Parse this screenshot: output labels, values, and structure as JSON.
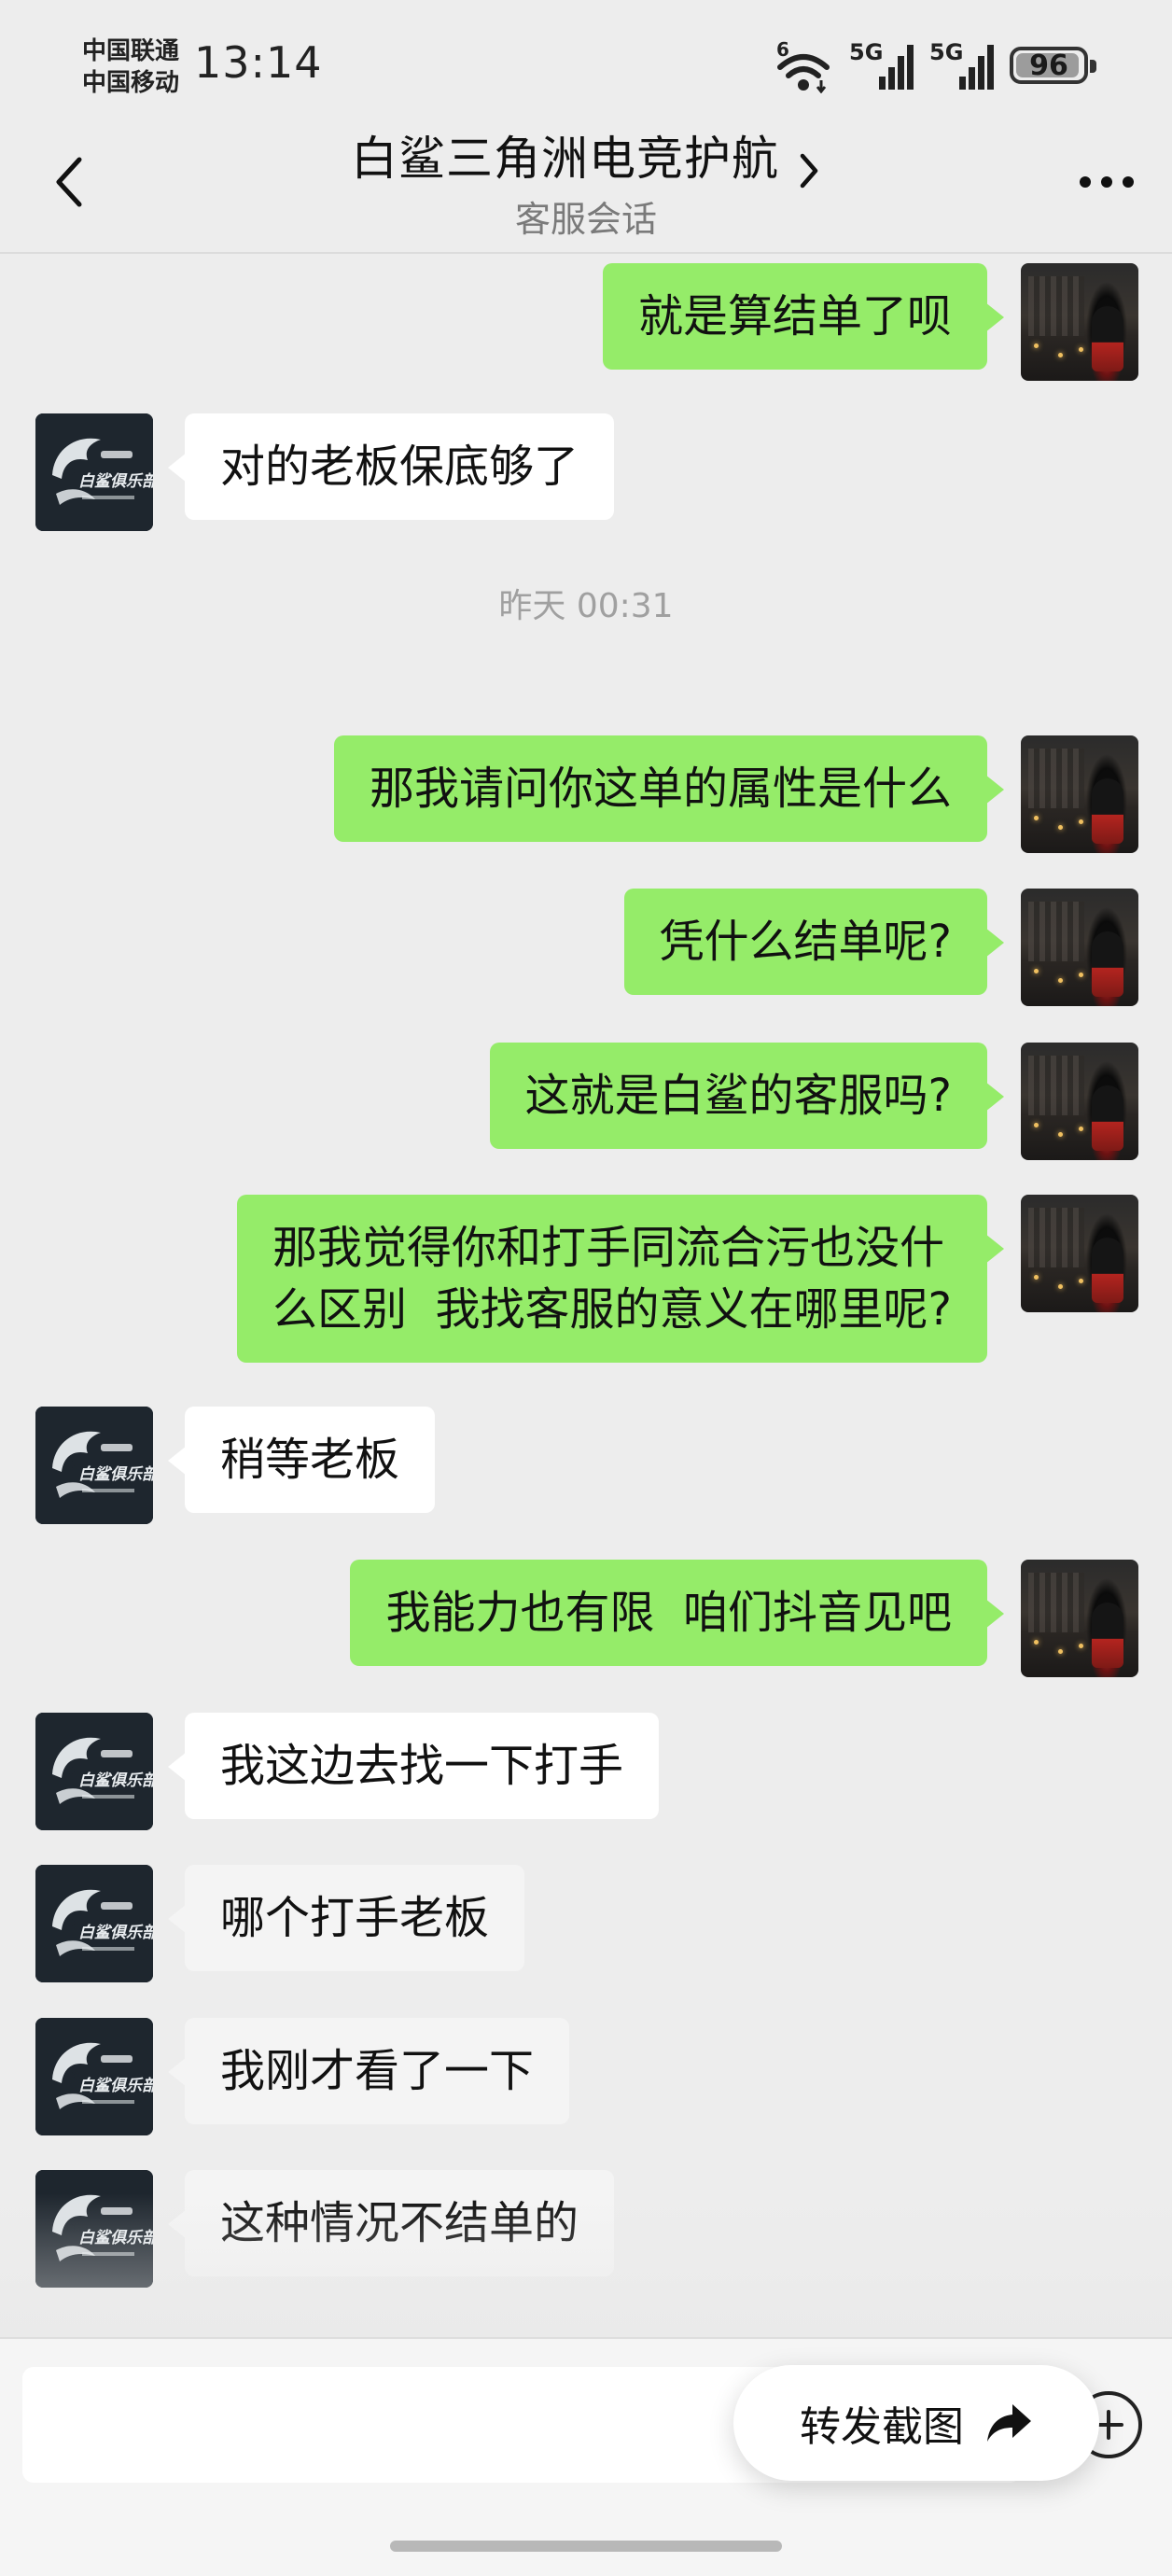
{
  "status_bar": {
    "carrier_1": "中国联通",
    "carrier_2": "中国移动",
    "time": "13:14",
    "wifi_badge": "6",
    "signal_1_label": "5G",
    "signal_2_label": "5G",
    "battery_level": "96",
    "battery_fraction": 0.96
  },
  "header": {
    "title": "白鲨三角洲电竞护航",
    "subtitle": "客服会话",
    "back_icon": "chevron-left-icon",
    "title_chevron_icon": "chevron-right-icon",
    "more_icon": "more-dots-icon"
  },
  "messages": [
    {
      "side": "right",
      "text": "就是算结单了呗"
    },
    {
      "side": "left",
      "text": "对的老板保底够了"
    },
    {
      "type": "timestamp",
      "text": "昨天 00:31"
    },
    {
      "side": "right",
      "text": "那我请问你这单的属性是什么"
    },
    {
      "side": "right",
      "text": "凭什么结单呢?"
    },
    {
      "side": "right",
      "text": "这就是白鲨的客服吗?"
    },
    {
      "side": "right",
      "text": "那我觉得你和打手同流合污也没什\n么区别  我找客服的意义在哪里呢?"
    },
    {
      "side": "left",
      "text": "稍等老板"
    },
    {
      "side": "right",
      "text": "我能力也有限  咱们抖音见吧"
    },
    {
      "side": "left",
      "text": "我这边去找一下打手"
    },
    {
      "side": "left",
      "text": "哪个打手老板"
    },
    {
      "side": "left",
      "text": "我刚才看了一下"
    },
    {
      "side": "left",
      "text": "这种情况不结单的"
    }
  ],
  "shop_avatar": {
    "logo_text": "白鲨俱乐部",
    "colors": {
      "bg": "#1e262e",
      "logo": "#e8ecef"
    }
  },
  "input_bar": {
    "placeholder": "",
    "plus_icon": "plus-circle-icon"
  },
  "floating_button": {
    "label": "转发截图",
    "icon": "share-arrow-icon"
  },
  "colors": {
    "background": "#ededed",
    "self_bubble": "#95ec69",
    "other_bubble": "#ffffff",
    "timestamp_text": "#a0a0a0"
  }
}
